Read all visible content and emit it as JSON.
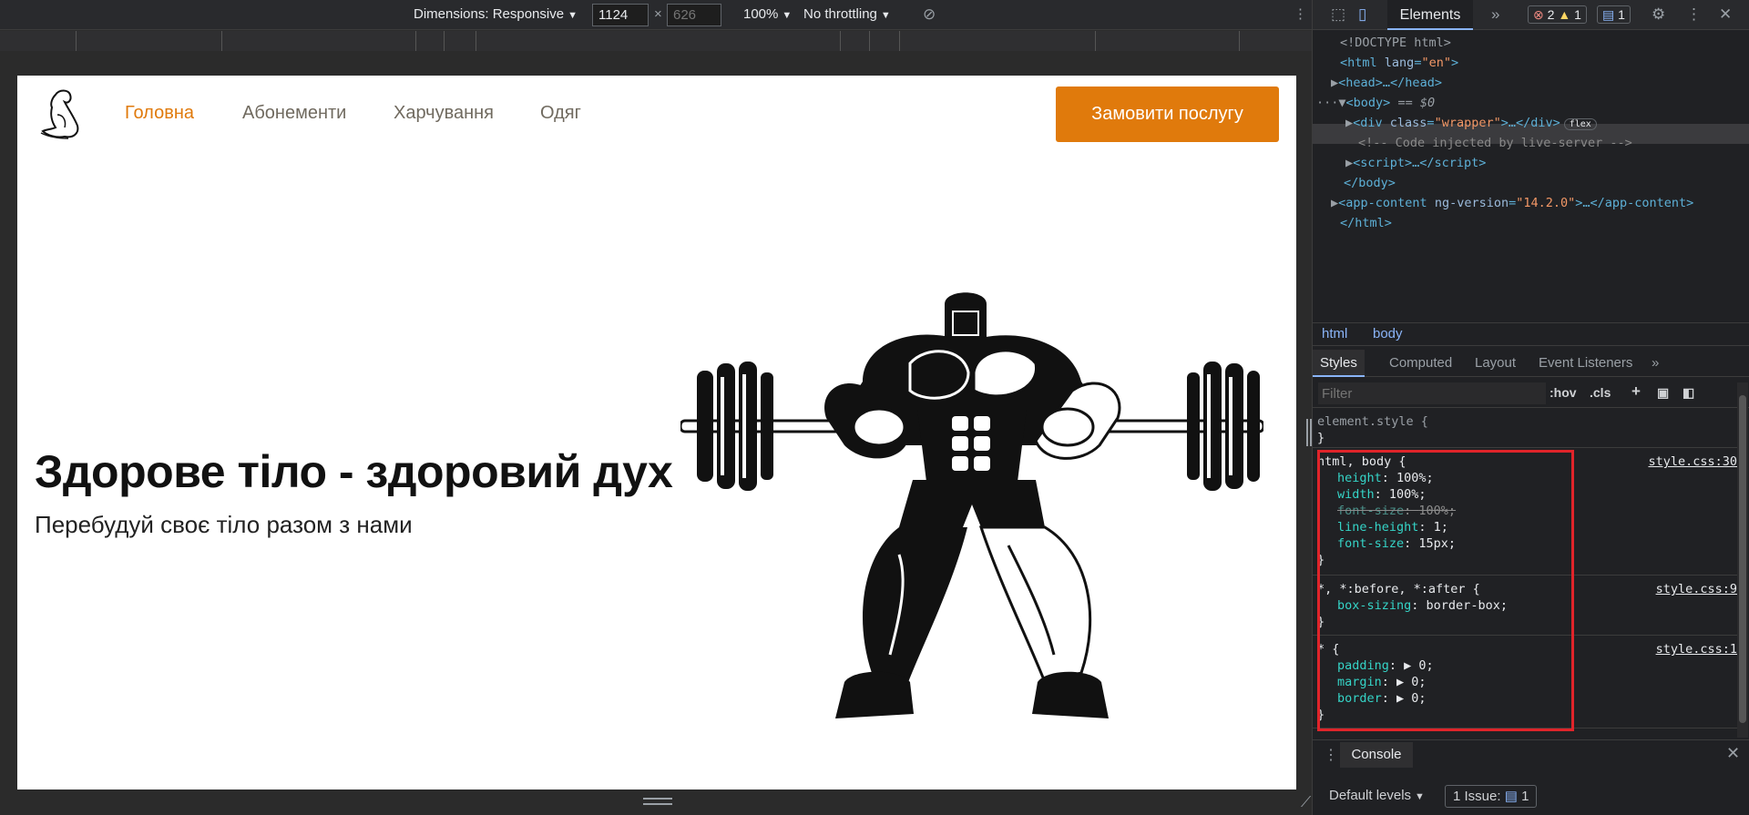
{
  "emulation": {
    "dimensions_label": "Dimensions: Responsive",
    "width_value": "1124",
    "height_placeholder": "626",
    "zoom": "100%",
    "throttling": "No throttling"
  },
  "site": {
    "nav": [
      {
        "label": "Головна",
        "active": true
      },
      {
        "label": "Абонементи",
        "active": false
      },
      {
        "label": "Харчування",
        "active": false
      },
      {
        "label": "Одяг",
        "active": false
      }
    ],
    "cta_label": "Замовити послугу",
    "hero_title": "Здорове тіло - здоровий дух",
    "hero_subtitle": "Перебудуй своє тіло разом з нами",
    "accent_color": "#e07a0c"
  },
  "devtools": {
    "main_tab": "Elements",
    "errors": "2",
    "warnings": "1",
    "messages": "1",
    "dom": {
      "doctype": "<!DOCTYPE html>",
      "html_open": "html",
      "lang_attr": "lang",
      "lang_val": "\"en\"",
      "head": "head",
      "body_note": "== $0",
      "wrapper_class": "\"wrapper\"",
      "flex_badge": "flex",
      "comment": "<!-- Code injected by live-server -->",
      "app_attr": "ng-version",
      "app_val": "\"14.2.0\""
    },
    "breadcrumbs": [
      "html",
      "body"
    ],
    "sub_tabs": [
      "Styles",
      "Computed",
      "Layout",
      "Event Listeners"
    ],
    "filter_placeholder": "Filter",
    "hov": ":hov",
    "cls": ".cls",
    "rules": {
      "element_style": "element.style {",
      "r1_sel": "html, body {",
      "r1_src": "style.css:30",
      "r1_props": [
        {
          "name": "height",
          "value": "100%;",
          "struck": false
        },
        {
          "name": "width",
          "value": "100%;",
          "struck": false
        },
        {
          "name": "font-size",
          "value": "100%;",
          "struck": true
        },
        {
          "name": "line-height",
          "value": "1;",
          "struck": false
        },
        {
          "name": "font-size",
          "value": "15px;",
          "struck": false
        }
      ],
      "r2_sel": "*, *:before, *:after {",
      "r2_src": "style.css:9",
      "r2_prop": {
        "name": "box-sizing",
        "value": "border-box;"
      },
      "r3_sel": "* {",
      "r3_src": "style.css:1",
      "r3_props": [
        {
          "name": "padding",
          "value": "0;"
        },
        {
          "name": "margin",
          "value": "0;"
        },
        {
          "name": "border",
          "value": "0;"
        }
      ],
      "close": "}"
    },
    "drawer_tab": "Console",
    "default_levels": "Default levels",
    "issues_label": "1 Issue:",
    "issues_count": "1"
  }
}
